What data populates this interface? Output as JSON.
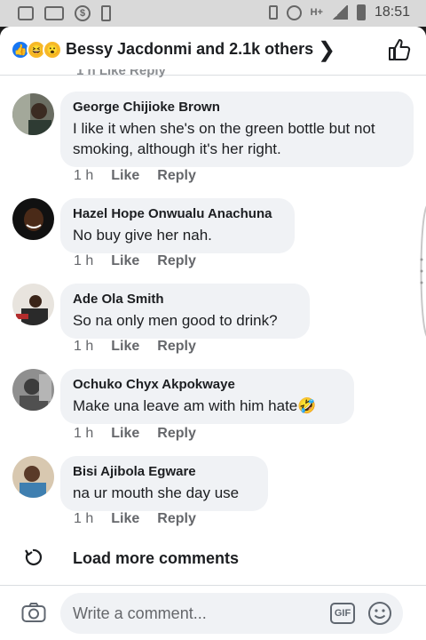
{
  "status_bar": {
    "time": "18:51",
    "network": "H+",
    "icons": [
      "image-icon",
      "gallery-icon",
      "data-saver-icon",
      "phone-icon",
      "vibrate-icon",
      "alarm-icon",
      "signal-icon",
      "battery-icon"
    ]
  },
  "header": {
    "reactions": [
      "like-icon",
      "haha-icon",
      "wow-icon"
    ],
    "title": "Bessy Jacdonmi and 2.1k others",
    "chevron": "chevron-right-icon",
    "like_icon": "thumbs-up-icon"
  },
  "partial_row_text": "1 h   Like   Reply",
  "comments": [
    {
      "author": "George Chijioke Brown",
      "text": "I like it when she's on the green bottle but not smoking, although it's her right.",
      "time": "1 h",
      "like_label": "Like",
      "reply_label": "Reply"
    },
    {
      "author": "Hazel Hope Onwualu Anachuna",
      "text": "No buy give her nah.",
      "time": "1 h",
      "like_label": "Like",
      "reply_label": "Reply"
    },
    {
      "author": "Ade Ola Smith",
      "text": "So na only men good to drink?",
      "time": "1 h",
      "like_label": "Like",
      "reply_label": "Reply"
    },
    {
      "author": "Ochuko Chyx Akpokwaye",
      "text": "Make una leave am with him hate🤣",
      "time": "1 h",
      "like_label": "Like",
      "reply_label": "Reply"
    },
    {
      "author": "Bisi Ajibola Egware",
      "text": "na ur mouth she day use",
      "time": "1 h",
      "like_label": "Like",
      "reply_label": "Reply"
    }
  ],
  "load_more": {
    "icon": "refresh-icon",
    "label": "Load more comments"
  },
  "composer": {
    "placeholder": "Write a comment...",
    "camera_icon": "camera-icon",
    "gif_label": "GIF",
    "emoji_icon": "smiley-icon"
  },
  "colors": {
    "bubble": "#f0f2f5",
    "text": "#1c1e21",
    "meta": "#65676b",
    "brand_blue": "#1877f2",
    "status_bar": "#d9d9d9"
  }
}
